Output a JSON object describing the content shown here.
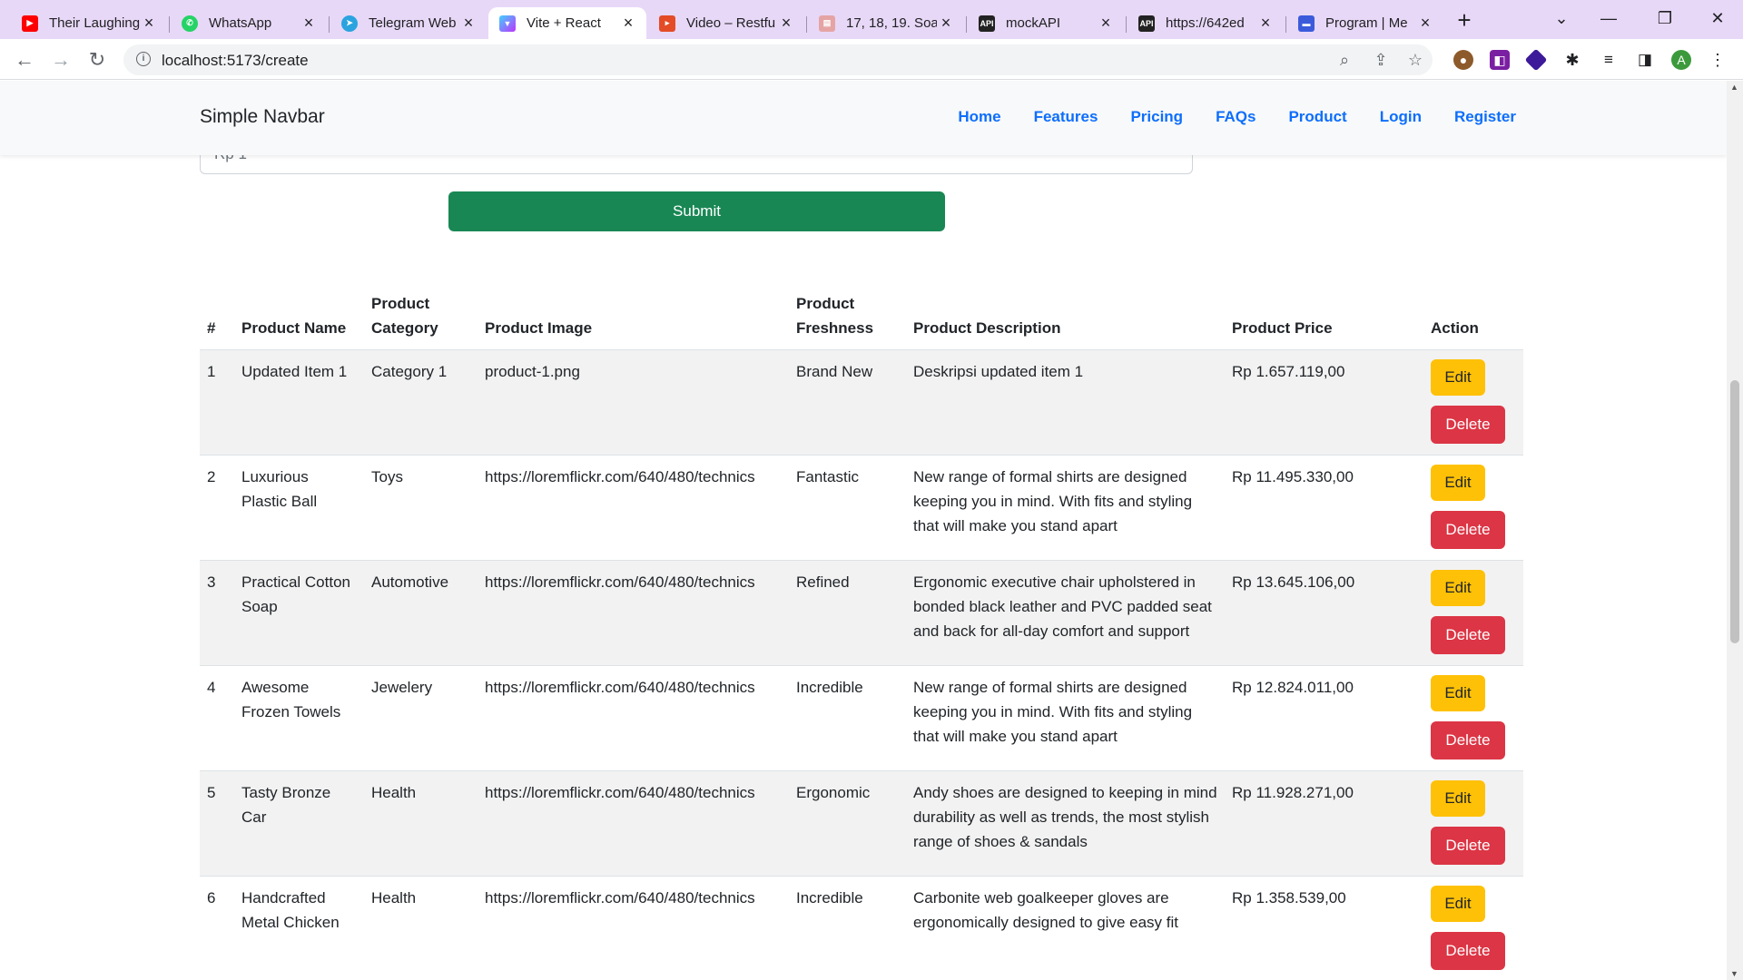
{
  "browser": {
    "tabs": [
      {
        "title": "Their Laughing",
        "icon": "youtube-icon",
        "color": "#ff0000"
      },
      {
        "title": "WhatsApp",
        "icon": "whatsapp-icon",
        "color": "#25d366"
      },
      {
        "title": "Telegram Web",
        "icon": "telegram-icon",
        "color": "#2aa3df"
      },
      {
        "title": "Vite + React",
        "icon": "vite-icon",
        "color": "#a259ff"
      },
      {
        "title": "Video – Restfu",
        "icon": "video-icon",
        "color": "#e34c26"
      },
      {
        "title": "17, 18, 19. Soa",
        "icon": "document-icon",
        "color": "#e5a4a4"
      },
      {
        "title": "mockAPI",
        "icon": "mockapi-icon",
        "color": "#222222"
      },
      {
        "title": "https://642ed",
        "icon": "mockapi-icon",
        "color": "#222222"
      },
      {
        "title": "Program | Me",
        "icon": "program-icon",
        "color": "#3b5bdb"
      }
    ],
    "url": "localhost:5173/create",
    "profile_initial": "A"
  },
  "navbar": {
    "brand": "Simple Navbar",
    "links": [
      "Home",
      "Features",
      "Pricing",
      "FAQs",
      "Product",
      "Login",
      "Register"
    ]
  },
  "form": {
    "price_input_value": "Rp 1",
    "submit_label": "Submit"
  },
  "table": {
    "headers": [
      "#",
      "Product Name",
      "Product Category",
      "Product Image",
      "Product Freshness",
      "Product Description",
      "Product Price",
      "Action"
    ],
    "edit_label": "Edit",
    "delete_label": "Delete",
    "rows": [
      {
        "no": "1",
        "name": "Updated Item 1",
        "category": "Category 1",
        "image": "product-1.png",
        "freshness": "Brand New",
        "description": "Deskripsi updated item 1",
        "price": "Rp 1.657.119,00"
      },
      {
        "no": "2",
        "name": "Luxurious Plastic Ball",
        "category": "Toys",
        "image": "https://loremflickr.com/640/480/technics",
        "freshness": "Fantastic",
        "description": "New range of formal shirts are designed keeping you in mind. With fits and styling that will make you stand apart",
        "price": "Rp 11.495.330,00"
      },
      {
        "no": "3",
        "name": "Practical Cotton Soap",
        "category": "Automotive",
        "image": "https://loremflickr.com/640/480/technics",
        "freshness": "Refined",
        "description": "Ergonomic executive chair upholstered in bonded black leather and PVC padded seat and back for all-day comfort and support",
        "price": "Rp 13.645.106,00"
      },
      {
        "no": "4",
        "name": "Awesome Frozen Towels",
        "category": "Jewelery",
        "image": "https://loremflickr.com/640/480/technics",
        "freshness": "Incredible",
        "description": "New range of formal shirts are designed keeping you in mind. With fits and styling that will make you stand apart",
        "price": "Rp 12.824.011,00"
      },
      {
        "no": "5",
        "name": "Tasty Bronze Car",
        "category": "Health",
        "image": "https://loremflickr.com/640/480/technics",
        "freshness": "Ergonomic",
        "description": "Andy shoes are designed to keeping in mind durability as well as trends, the most stylish range of shoes & sandals",
        "price": "Rp 11.928.271,00"
      },
      {
        "no": "6",
        "name": "Handcrafted Metal Chicken",
        "category": "Health",
        "image": "https://loremflickr.com/640/480/technics",
        "freshness": "Incredible",
        "description": "Carbonite web goalkeeper gloves are ergonomically designed to give easy fit",
        "price": "Rp 1.358.539,00"
      }
    ]
  }
}
